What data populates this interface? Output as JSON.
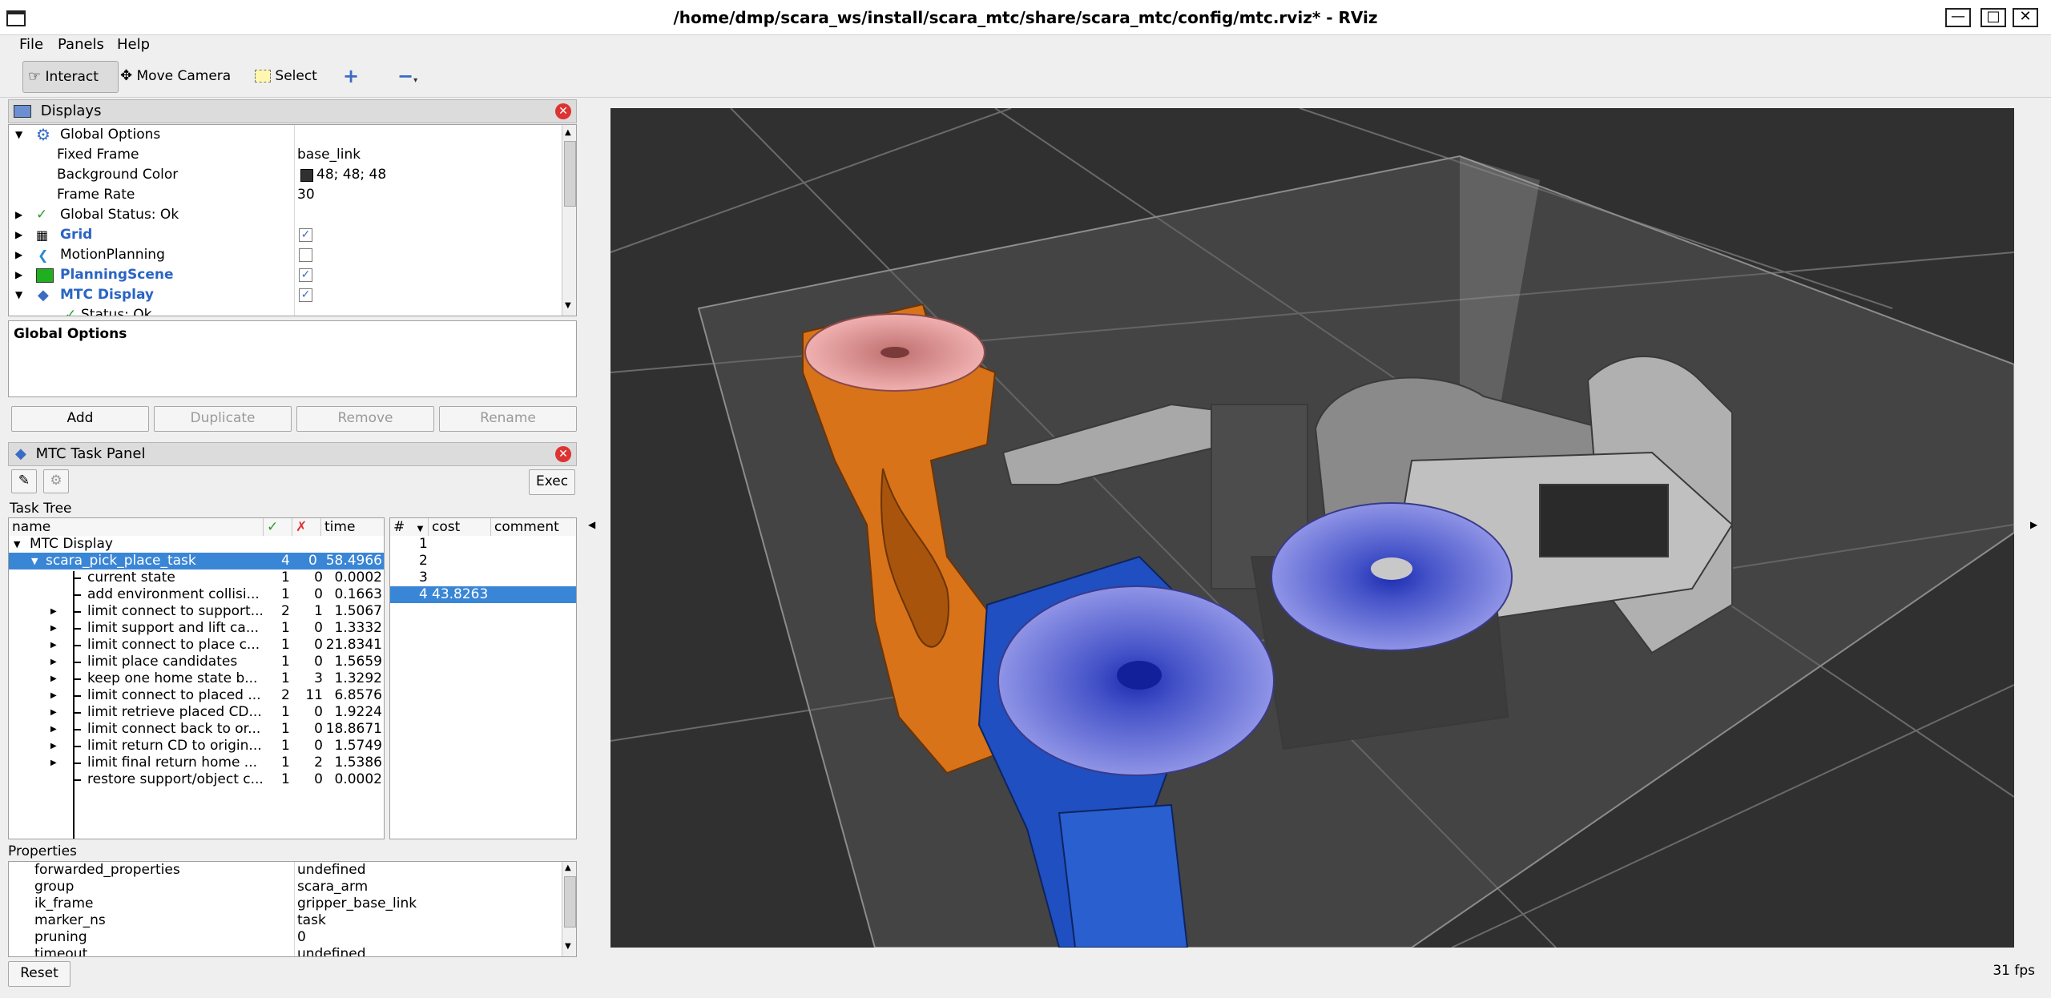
{
  "window": {
    "title": "/home/dmp/scara_ws/install/scara_mtc/share/scara_mtc/config/mtc.rviz* - RViz"
  },
  "menu": [
    "File",
    "Panels",
    "Help"
  ],
  "toolbar": {
    "interact": "Interact",
    "move_camera": "Move Camera",
    "select": "Select"
  },
  "displays": {
    "title": "Displays",
    "items": [
      {
        "label": "Global Options",
        "value": ""
      },
      {
        "label": "Fixed Frame",
        "value": "base_link"
      },
      {
        "label": "Background Color",
        "value": "48; 48; 48"
      },
      {
        "label": "Frame Rate",
        "value": "30"
      },
      {
        "label": "Global Status: Ok",
        "value": ""
      },
      {
        "label": "Grid",
        "value": ""
      },
      {
        "label": "MotionPlanning",
        "value": ""
      },
      {
        "label": "PlanningScene",
        "value": ""
      },
      {
        "label": "MTC Display",
        "value": ""
      },
      {
        "label": "Status: Ok",
        "value": ""
      }
    ],
    "description_title": "Global Options",
    "buttons": {
      "add": "Add",
      "duplicate": "Duplicate",
      "remove": "Remove",
      "rename": "Rename"
    }
  },
  "mtc": {
    "title": "MTC Task Panel",
    "exec": "Exec",
    "task_tree_label": "Task Tree",
    "columns": {
      "name": "name",
      "ok": "✓",
      "fail": "✗",
      "time": "time"
    },
    "root": "MTC Display",
    "task": {
      "name": "scara_pick_place_task",
      "ok": "4",
      "fail": "0",
      "time": "58.4966"
    },
    "stages": [
      {
        "name": "current state",
        "ok": "1",
        "fail": "0",
        "time": "0.0002"
      },
      {
        "name": "add environment collisi...",
        "ok": "1",
        "fail": "0",
        "time": "0.1663"
      },
      {
        "name": "limit connect to support...",
        "ok": "2",
        "fail": "1",
        "time": "1.5067"
      },
      {
        "name": "limit support and lift ca...",
        "ok": "1",
        "fail": "0",
        "time": "1.3332"
      },
      {
        "name": "limit connect to place c...",
        "ok": "1",
        "fail": "0",
        "time": "21.8341"
      },
      {
        "name": "limit place candidates",
        "ok": "1",
        "fail": "0",
        "time": "1.5659"
      },
      {
        "name": "keep one home state b...",
        "ok": "1",
        "fail": "3",
        "time": "1.3292"
      },
      {
        "name": "limit connect to placed ...",
        "ok": "2",
        "fail": "11",
        "time": "6.8576"
      },
      {
        "name": "limit retrieve placed CD...",
        "ok": "1",
        "fail": "0",
        "time": "1.9224"
      },
      {
        "name": "limit connect back to or...",
        "ok": "1",
        "fail": "0",
        "time": "18.8671"
      },
      {
        "name": "limit return CD to origin...",
        "ok": "1",
        "fail": "0",
        "time": "1.5749"
      },
      {
        "name": "limit final return home ...",
        "ok": "1",
        "fail": "2",
        "time": "1.5386"
      },
      {
        "name": "restore support/object c...",
        "ok": "1",
        "fail": "0",
        "time": "0.0002"
      }
    ],
    "solution_columns": {
      "id": "#",
      "cost": "cost",
      "comment": "comment"
    },
    "solutions": [
      {
        "id": "1",
        "cost": ""
      },
      {
        "id": "2",
        "cost": ""
      },
      {
        "id": "3",
        "cost": ""
      },
      {
        "id": "4",
        "cost": "43.8263"
      }
    ]
  },
  "properties": {
    "label": "Properties",
    "rows": [
      {
        "key": "forwarded_properties",
        "value": "undefined"
      },
      {
        "key": "group",
        "value": "scara_arm"
      },
      {
        "key": "ik_frame",
        "value": "gripper_base_link"
      },
      {
        "key": "marker_ns",
        "value": "task"
      },
      {
        "key": "pruning",
        "value": "0"
      },
      {
        "key": "timeout",
        "value": "undefined"
      }
    ],
    "reset": "Reset"
  },
  "status": {
    "fps": "31 fps"
  },
  "colors": {
    "selection": "#3a86d6",
    "viewport_bg": "#303030",
    "bg_swatch": "#303030"
  }
}
